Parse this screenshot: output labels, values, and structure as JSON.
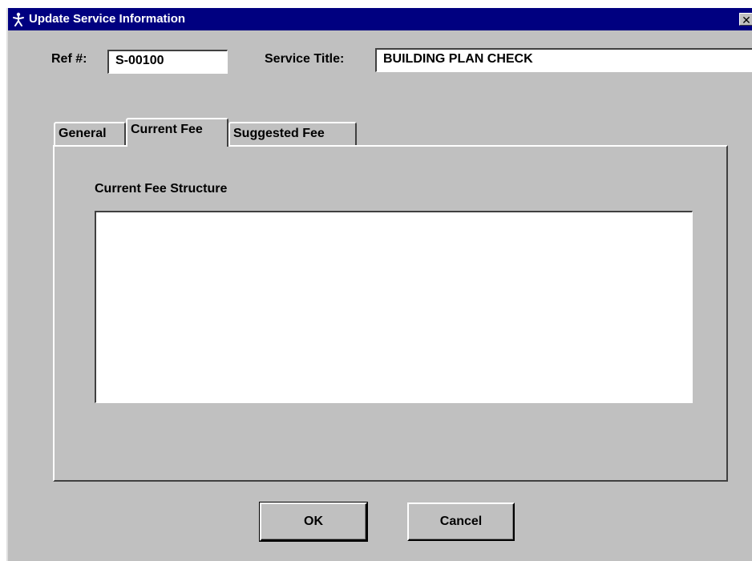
{
  "window": {
    "title": "Update Service Information",
    "close_glyph": "✕"
  },
  "header": {
    "ref_label": "Ref #:",
    "ref_value": "S-00100",
    "service_title_label": "Service Title:",
    "service_title_value": "BUILDING PLAN CHECK"
  },
  "tabs": [
    {
      "label": "General",
      "active": false
    },
    {
      "label": "Current Fee",
      "active": true
    },
    {
      "label": "Suggested Fee",
      "active": false
    }
  ],
  "panel": {
    "heading": "Current Fee Structure",
    "memo_value": ""
  },
  "buttons": {
    "ok_label": "OK",
    "cancel_label": "Cancel"
  },
  "icons": {
    "app_icon": "figure-icon",
    "close_icon": "close-icon"
  },
  "colors": {
    "titlebar": "#000080",
    "face": "#c0c0c0",
    "field": "#ffffff"
  }
}
